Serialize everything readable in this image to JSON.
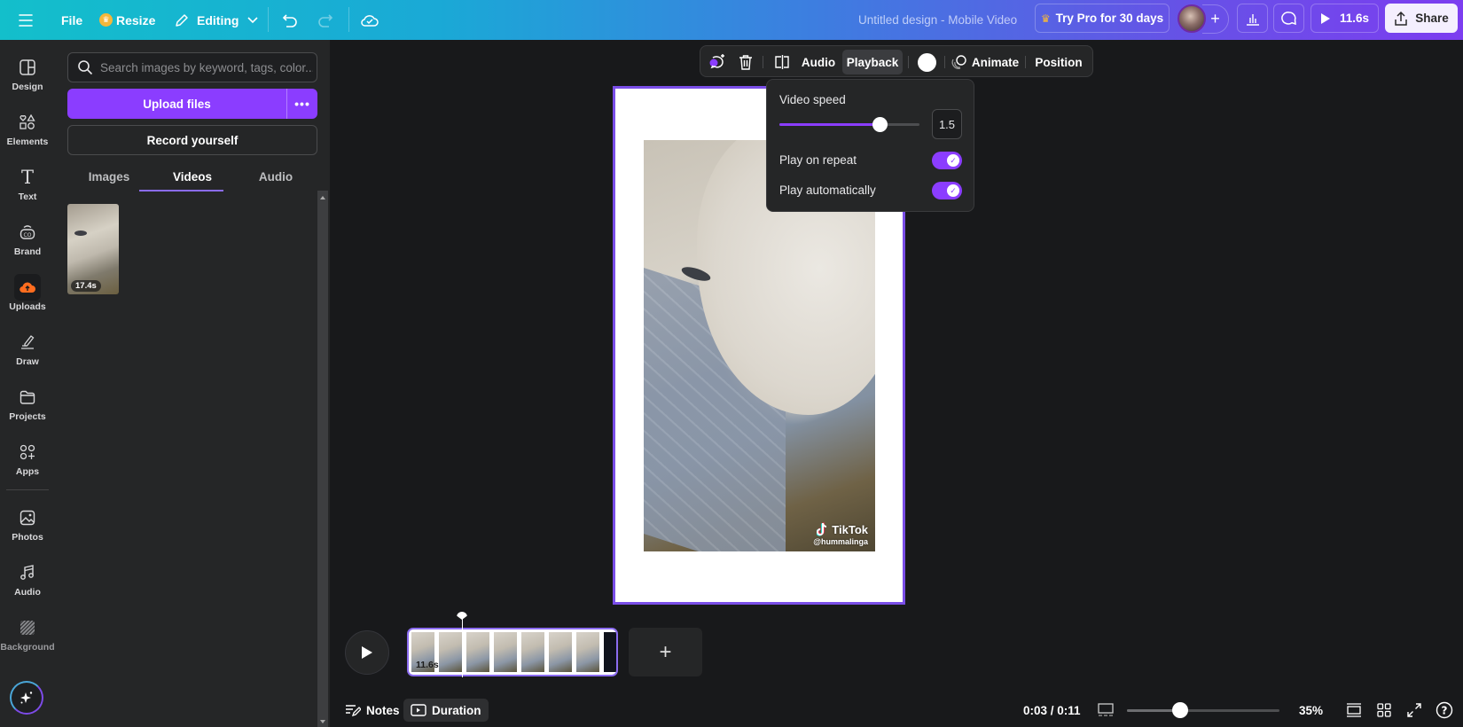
{
  "topbar": {
    "file_label": "File",
    "resize_label": "Resize",
    "editing_label": "Editing",
    "design_title": "Untitled design - Mobile Video",
    "try_pro_label": "Try Pro for 30 days",
    "play_duration": "11.6s",
    "share_label": "Share"
  },
  "rail": {
    "items": [
      {
        "label": "Design",
        "icon": "layout-icon"
      },
      {
        "label": "Elements",
        "icon": "shapes-icon"
      },
      {
        "label": "Text",
        "icon": "text-icon"
      },
      {
        "label": "Brand",
        "icon": "brand-icon"
      },
      {
        "label": "Uploads",
        "icon": "cloud-upload-icon"
      },
      {
        "label": "Draw",
        "icon": "draw-icon"
      },
      {
        "label": "Projects",
        "icon": "folder-icon"
      },
      {
        "label": "Apps",
        "icon": "apps-icon"
      },
      {
        "label": "Photos",
        "icon": "photo-icon"
      },
      {
        "label": "Audio",
        "icon": "music-icon"
      },
      {
        "label": "Background",
        "icon": "background-icon"
      }
    ]
  },
  "panel": {
    "search_placeholder": "Search images by keyword, tags, color...",
    "upload_label": "Upload files",
    "more_label": "•••",
    "record_label": "Record yourself",
    "tabs": [
      {
        "label": "Images",
        "active": false
      },
      {
        "label": "Videos",
        "active": true
      },
      {
        "label": "Audio",
        "active": false
      }
    ],
    "uploads": [
      {
        "duration": "17.4s"
      }
    ]
  },
  "context_toolbar": {
    "audio_label": "Audio",
    "playback_label": "Playback",
    "animate_label": "Animate",
    "position_label": "Position",
    "color_swatch": "#ffffff"
  },
  "playback_popover": {
    "video_speed_label": "Video speed",
    "speed_value": "1.5",
    "speed_min": 0.25,
    "speed_max": 2,
    "play_on_repeat_label": "Play on repeat",
    "play_on_repeat": true,
    "play_automatically_label": "Play automatically",
    "play_automatically": true
  },
  "canvas": {
    "watermark_brand": "TikTok",
    "watermark_handle": "@hummalinga"
  },
  "timeline": {
    "clip_duration": "11.6s",
    "frame_count": 8
  },
  "bottombar": {
    "notes_label": "Notes",
    "duration_label": "Duration",
    "time_readout": "0:03 / 0:11",
    "zoom_percent": "35%",
    "zoom_level": 0.35
  },
  "colors": {
    "accent": "#8b3dff",
    "selection": "#7a4ee8",
    "uploads_icon": "#ff6d1f"
  }
}
